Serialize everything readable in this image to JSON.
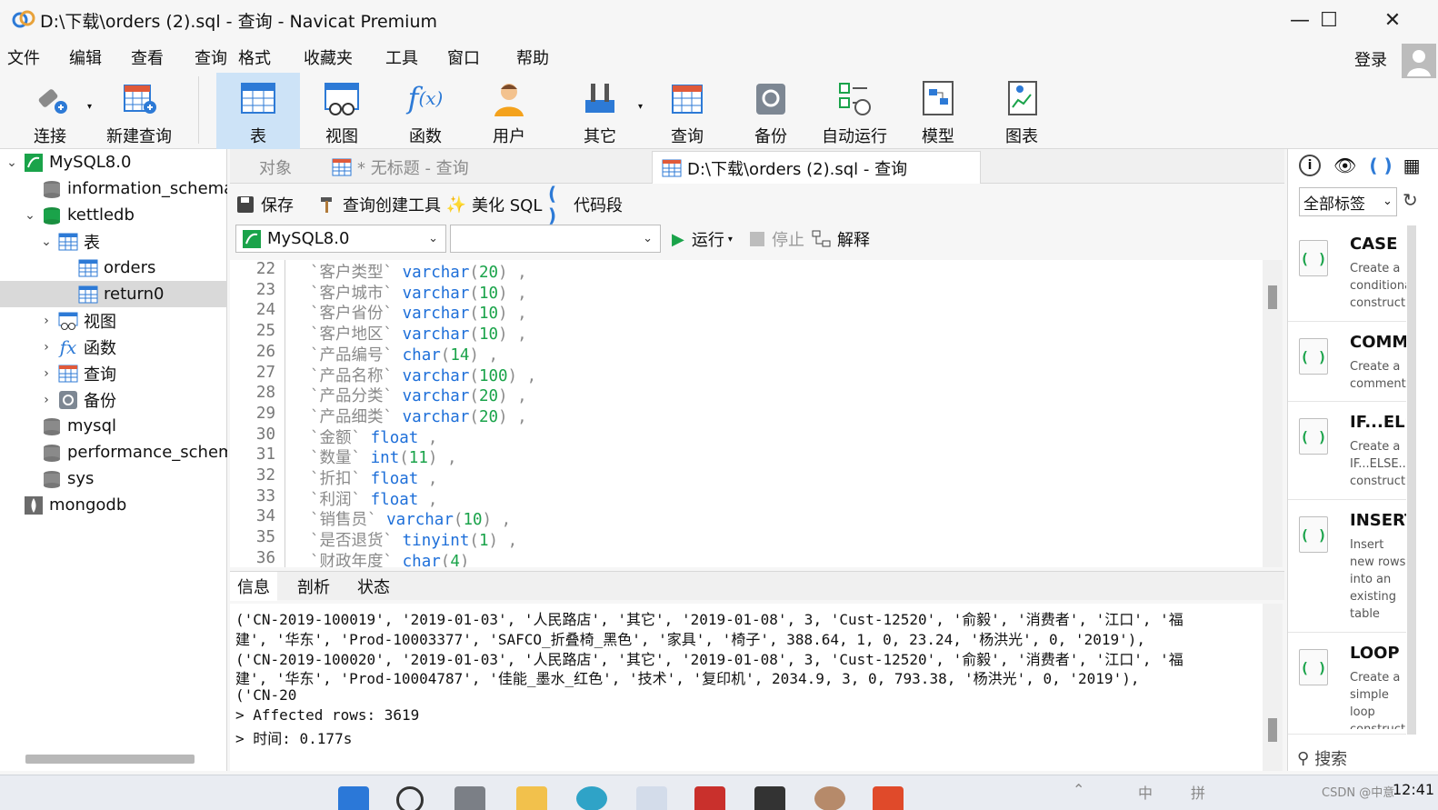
{
  "window": {
    "title": "D:\\下载\\orders (2).sql - 查询 - Navicat Premium"
  },
  "menu": [
    "文件",
    "编辑",
    "查看",
    "查询",
    "格式",
    "收藏夹",
    "工具",
    "窗口",
    "帮助"
  ],
  "account": {
    "login": "登录"
  },
  "toolbar": {
    "connect": "连接",
    "new_query": "新建查询",
    "table": "表",
    "view": "视图",
    "function": "函数",
    "user": "用户",
    "other": "其它",
    "query": "查询",
    "backup": "备份",
    "automation": "自动运行",
    "model": "模型",
    "chart": "图表"
  },
  "tree": {
    "items": [
      {
        "label": "MySQL8.0",
        "icon": "mysql-connection-icon"
      },
      {
        "label": "information_schema",
        "icon": "database-icon"
      },
      {
        "label": "kettledb",
        "icon": "database-icon"
      },
      {
        "label": "表",
        "icon": "table-icon"
      },
      {
        "label": "orders",
        "icon": "table-icon"
      },
      {
        "label": "return0",
        "icon": "table-icon"
      },
      {
        "label": "视图",
        "icon": "view-icon"
      },
      {
        "label": "函数",
        "icon": "function-icon"
      },
      {
        "label": "查询",
        "icon": "query-icon"
      },
      {
        "label": "备份",
        "icon": "backup-icon"
      },
      {
        "label": "mysql",
        "icon": "database-icon"
      },
      {
        "label": "performance_schema",
        "icon": "database-icon"
      },
      {
        "label": "sys",
        "icon": "database-icon"
      },
      {
        "label": "mongodb",
        "icon": "mongodb-connection-icon"
      }
    ]
  },
  "tabs": {
    "objects": "对象",
    "untitled": "* 无标题 - 查询",
    "current": "D:\\下载\\orders (2).sql - 查询"
  },
  "query_toolbar": {
    "save": "保存",
    "builder": "查询创建工具",
    "beautify": "美化 SQL",
    "snippet": "代码段",
    "run": "运行",
    "stop": "停止",
    "explain": "解释"
  },
  "connection": {
    "selected": "MySQL8.0",
    "database": ""
  },
  "code_lines": [
    {
      "n": "22",
      "name": "`客户类型`",
      "type": "varchar",
      "len": "20",
      "tail": " ,"
    },
    {
      "n": "23",
      "name": "`客户城市`",
      "type": "varchar",
      "len": "10",
      "tail": " ,"
    },
    {
      "n": "24",
      "name": "`客户省份`",
      "type": "varchar",
      "len": "10",
      "tail": " ,"
    },
    {
      "n": "25",
      "name": "`客户地区`",
      "type": "varchar",
      "len": "10",
      "tail": " ,"
    },
    {
      "n": "26",
      "name": "`产品编号`",
      "type": "char",
      "len": "14",
      "tail": " ,"
    },
    {
      "n": "27",
      "name": "`产品名称`",
      "type": "varchar",
      "len": "100",
      "tail": " ,"
    },
    {
      "n": "28",
      "name": "`产品分类`",
      "type": "varchar",
      "len": "20",
      "tail": " ,"
    },
    {
      "n": "29",
      "name": "`产品细类`",
      "type": "varchar",
      "len": "20",
      "tail": " ,"
    },
    {
      "n": "30",
      "name": "`金额`",
      "type": "float",
      "len": "",
      "tail": " ,"
    },
    {
      "n": "31",
      "name": "`数量`",
      "type": "int",
      "len": "11",
      "tail": " ,"
    },
    {
      "n": "32",
      "name": "`折扣`",
      "type": "float",
      "len": "",
      "tail": " ,"
    },
    {
      "n": "33",
      "name": "`利润`",
      "type": "float",
      "len": "",
      "tail": " ,"
    },
    {
      "n": "34",
      "name": "`销售员`",
      "type": "varchar",
      "len": "10",
      "tail": " ,"
    },
    {
      "n": "35",
      "name": "`是否退货`",
      "type": "tinyint",
      "len": "1",
      "tail": " ,"
    },
    {
      "n": "36",
      "name": "`财政年度`",
      "type": "char",
      "len": "4",
      "tail": ""
    }
  ],
  "bottom_tabs": {
    "info": "信息",
    "profile": "剖析",
    "status": "状态"
  },
  "output_lines": [
    "('CN-2019-100019', '2019-01-03', '人民路店', '其它', '2019-01-08', 3, 'Cust-12520', '俞毅', '消费者', '江口', '福",
    "建', '华东', 'Prod-10003377', 'SAFCO_折叠椅_黑色', '家具', '椅子', 388.64, 1, 0, 23.24, '杨洪光', 0, '2019'),",
    "('CN-2019-100020', '2019-01-03', '人民路店', '其它', '2019-01-08', 3, 'Cust-12520', '俞毅', '消费者', '江口', '福",
    "建', '华东', 'Prod-10004787', '佳能_墨水_红色', '技术', '复印机', 2034.9, 3, 0, 793.38, '杨洪光', 0, '2019'),",
    "('CN-20",
    "> Affected rows: 3619",
    "> 时间: 0.177s"
  ],
  "snippets": {
    "filter": "全部标签",
    "search": "搜索",
    "items": [
      {
        "title": "CASE",
        "desc": "Create a conditional construct"
      },
      {
        "title": "COMMENT",
        "desc": "Create a comment"
      },
      {
        "title": "IF...ELSE",
        "desc": "Create a IF...ELSE... construct"
      },
      {
        "title": "INSERT",
        "desc": "Insert new rows into an existing table"
      },
      {
        "title": "LOOP",
        "desc": "Create a simple loop construct"
      }
    ]
  },
  "taskbar": {
    "tray": [
      "中",
      "拼"
    ],
    "clock": "12:41",
    "watermark": "CSDN @中意"
  },
  "colors": {
    "keyword": "#1e6fd9",
    "number": "#1aa34a",
    "selection": "#cde3f7",
    "run": "#1aa34a"
  }
}
